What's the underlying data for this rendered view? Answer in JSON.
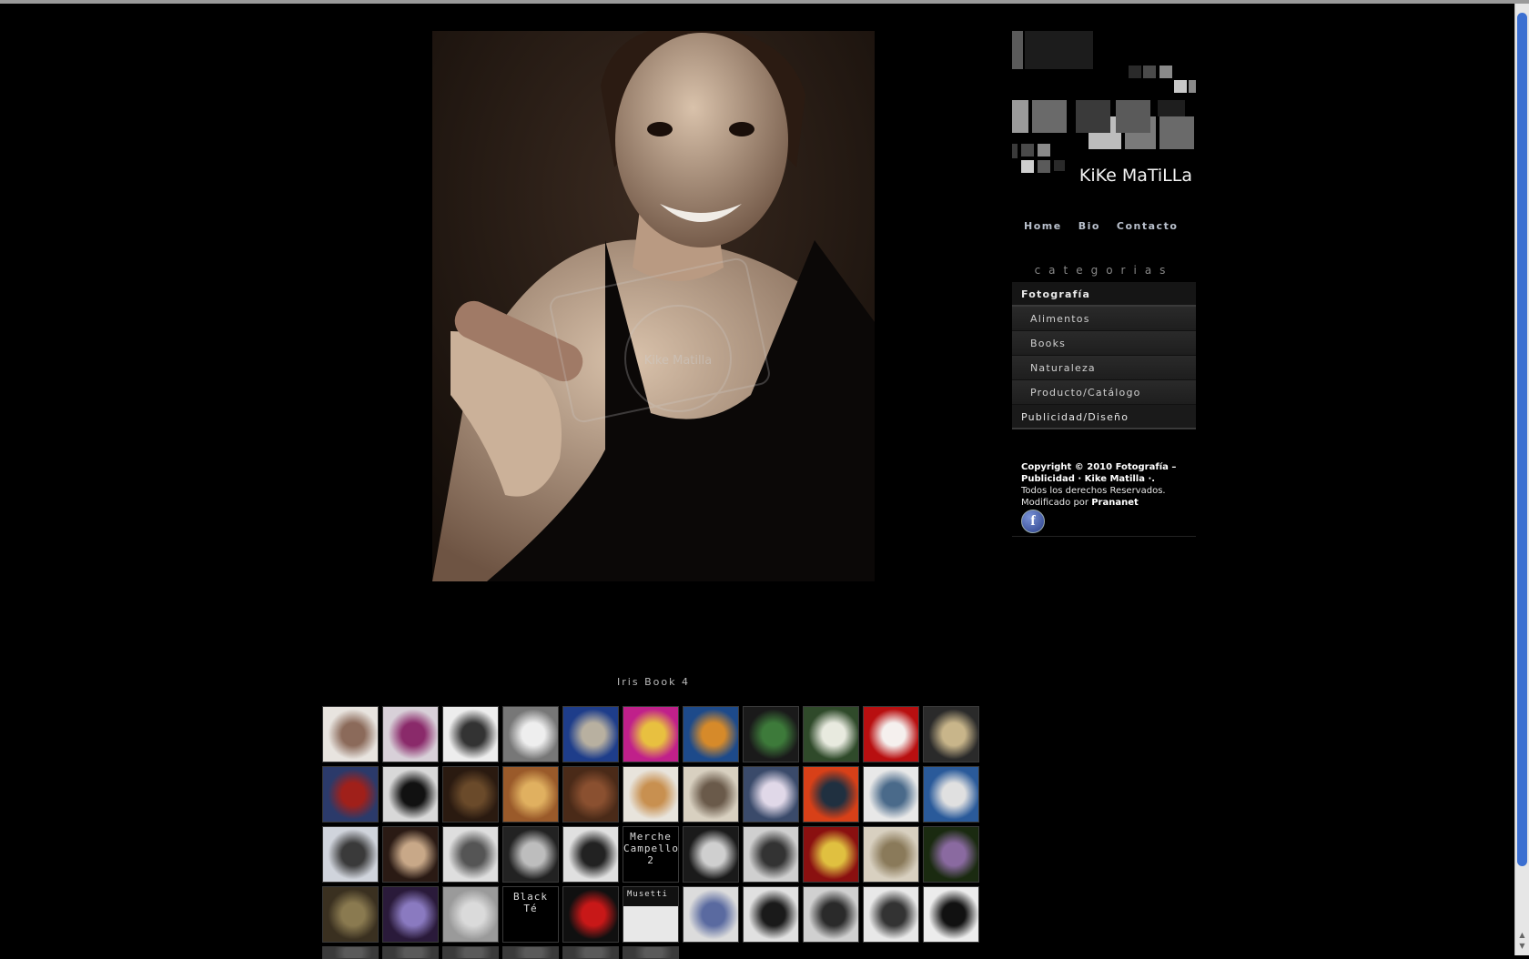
{
  "site": {
    "logo_text": "KiKe MaTiLLa",
    "nav": [
      "Home",
      "Bio",
      "Contacto"
    ],
    "categories_title": "categorias",
    "menu": {
      "top": "Fotografía",
      "subs": [
        "Alimentos",
        "Books",
        "Naturaleza",
        "Producto/Catálogo"
      ],
      "last": "Publicidad/Diseño"
    },
    "footer": {
      "line1": "Copyright © 2010 Fotografía – Publicidad · Kike Matilla ·.",
      "line2": "Todos los derechos Reservados.",
      "line3_prefix": "Modificado por ",
      "line3_link": "Prananet"
    },
    "facebook_icon": "facebook-icon"
  },
  "photo": {
    "caption": "Iris Book 4",
    "watermark": "Kike Matilla"
  },
  "thumbnails": [
    {
      "style": "portrait-light"
    },
    {
      "style": "magenta-portrait"
    },
    {
      "style": "bw-portrait"
    },
    {
      "style": "bw-legs"
    },
    {
      "style": "blue-landscape"
    },
    {
      "style": "pink-flower"
    },
    {
      "style": "orange-food"
    },
    {
      "style": "green-cactus"
    },
    {
      "style": "white-flowers"
    },
    {
      "style": "red-cocktail"
    },
    {
      "style": "food-bw"
    },
    {
      "style": "red-blue-product"
    },
    {
      "style": "black-bag"
    },
    {
      "style": "brown-bag"
    },
    {
      "style": "candy"
    },
    {
      "style": "chocolates"
    },
    {
      "style": "food-white"
    },
    {
      "style": "food-cream"
    },
    {
      "style": "dessert-blue"
    },
    {
      "style": "red-fitness"
    },
    {
      "style": "white-fitness"
    },
    {
      "style": "blue-fitness"
    },
    {
      "style": "yoga-light"
    },
    {
      "style": "portrait-sepia"
    },
    {
      "style": "portrait-bw"
    },
    {
      "style": "portrait-dark"
    },
    {
      "style": "bw-pose"
    },
    {
      "style": "text",
      "label": "Merche Campello 2"
    },
    {
      "style": "bw-woman"
    },
    {
      "style": "bw-woman2"
    },
    {
      "style": "red-plate"
    },
    {
      "style": "insect-light"
    },
    {
      "style": "green-flower"
    },
    {
      "style": "sepia-stone"
    },
    {
      "style": "lightning"
    },
    {
      "style": "grey-sand"
    },
    {
      "style": "text",
      "label": "Black Té"
    },
    {
      "style": "red-gift"
    },
    {
      "style": "musetti",
      "label": "Musetti"
    },
    {
      "style": "vodka-bottle"
    },
    {
      "style": "bw-fashion"
    },
    {
      "style": "bw-fashion2"
    },
    {
      "style": "bw-fashion3"
    },
    {
      "style": "bw-fashion4"
    },
    {
      "style": "partial"
    },
    {
      "style": "partial"
    },
    {
      "style": "partial"
    },
    {
      "style": "partial"
    },
    {
      "style": "partial"
    },
    {
      "style": "partial"
    }
  ],
  "colors": {
    "background": "#000000",
    "scrollbar_thumb": "#3b6fd1",
    "menu_bg": "#252525"
  }
}
